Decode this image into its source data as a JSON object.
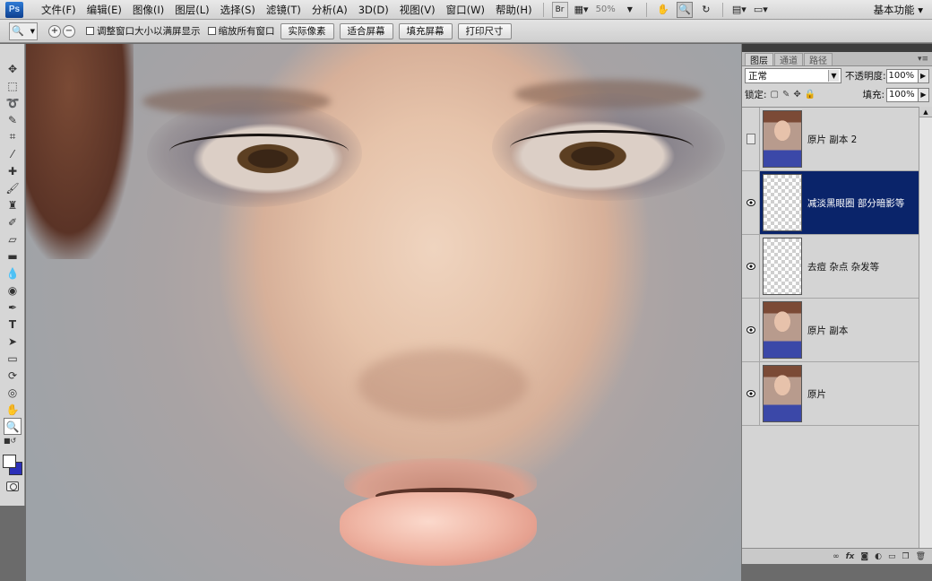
{
  "app": {
    "logo_text": "Ps"
  },
  "menu": [
    "文件(F)",
    "编辑(E)",
    "图像(I)",
    "图层(L)",
    "选择(S)",
    "滤镜(T)",
    "分析(A)",
    "3D(D)",
    "视图(V)",
    "窗口(W)",
    "帮助(H)"
  ],
  "appbar": {
    "br_label": "Br",
    "zoom": "50%",
    "workspace": "基本功能"
  },
  "options": {
    "checkbox_resize": "调整窗口大小以满屏显示",
    "checkbox_zoom_all": "缩放所有窗口",
    "btn_actual_pixels": "实际像素",
    "btn_fit_screen": "适合屏幕",
    "btn_fill_screen": "填充屏幕",
    "btn_print_size": "打印尺寸"
  },
  "swatches": {
    "foreground": "#ffffff",
    "background": "#2b2fb8"
  },
  "layers_panel": {
    "tabs": [
      "图层",
      "通道",
      "路径"
    ],
    "blend_mode": "正常",
    "opacity_label": "不透明度:",
    "opacity": "100%",
    "lock_label": "锁定:",
    "fill_label": "填充:",
    "fill": "100%",
    "layers": [
      {
        "name": "原片 副本 2",
        "visible": false,
        "selected": false,
        "thumb": "photo"
      },
      {
        "name": "减淡黑眼圈 部分暗影等",
        "visible": true,
        "selected": true,
        "thumb": "transparent"
      },
      {
        "name": "去痘 杂点 杂发等",
        "visible": true,
        "selected": false,
        "thumb": "transparent"
      },
      {
        "name": "原片 副本",
        "visible": true,
        "selected": false,
        "thumb": "photo"
      },
      {
        "name": "原片",
        "visible": true,
        "selected": false,
        "thumb": "photo"
      }
    ],
    "footer_icons": [
      "link-icon",
      "fx-icon",
      "mask-icon",
      "adjustment-icon",
      "group-icon",
      "new-layer-icon",
      "trash-icon"
    ]
  }
}
